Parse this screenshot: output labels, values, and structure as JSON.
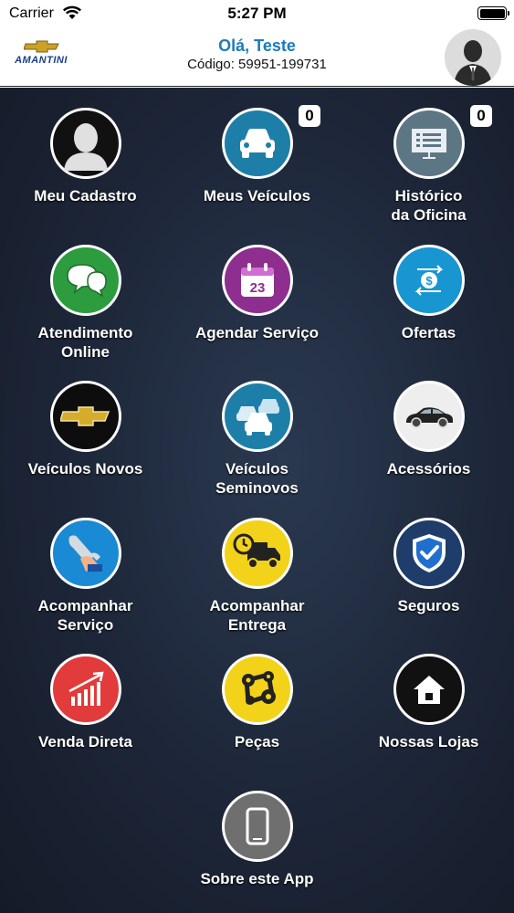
{
  "status_bar": {
    "carrier": "Carrier",
    "time": "5:27 PM"
  },
  "header": {
    "logo_text": "AMANTINI",
    "greeting": "Olá, Teste",
    "code_label": "Código:",
    "code_value": "59951-199731"
  },
  "badges": {
    "meus_veiculos": "0",
    "historico": "0"
  },
  "menu": {
    "meu_cadastro": "Meu Cadastro",
    "meus_veiculos": "Meus Veículos",
    "historico": "Histórico\nda Oficina",
    "atendimento": "Atendimento\nOnline",
    "agendar": "Agendar Serviço",
    "agendar_day": "23",
    "ofertas": "Ofertas",
    "veiculos_novos": "Veículos Novos",
    "seminovos": "Veículos\nSeminovos",
    "acessorios": "Acessórios",
    "acomp_servico": "Acompanhar\nServiço",
    "acomp_entrega": "Acompanhar\nEntrega",
    "seguros": "Seguros",
    "venda_direta": "Venda Direta",
    "pecas": "Peças",
    "lojas": "Nossas Lojas",
    "sobre": "Sobre este App"
  },
  "colors": {
    "header_blue": "#1e7bb8",
    "teal": "#1d7fa8",
    "green": "#2c9c3e",
    "purple": "#8e2e8e",
    "yellow": "#f3d21a",
    "red": "#e23b3b",
    "gray": "#6f6f6f"
  }
}
